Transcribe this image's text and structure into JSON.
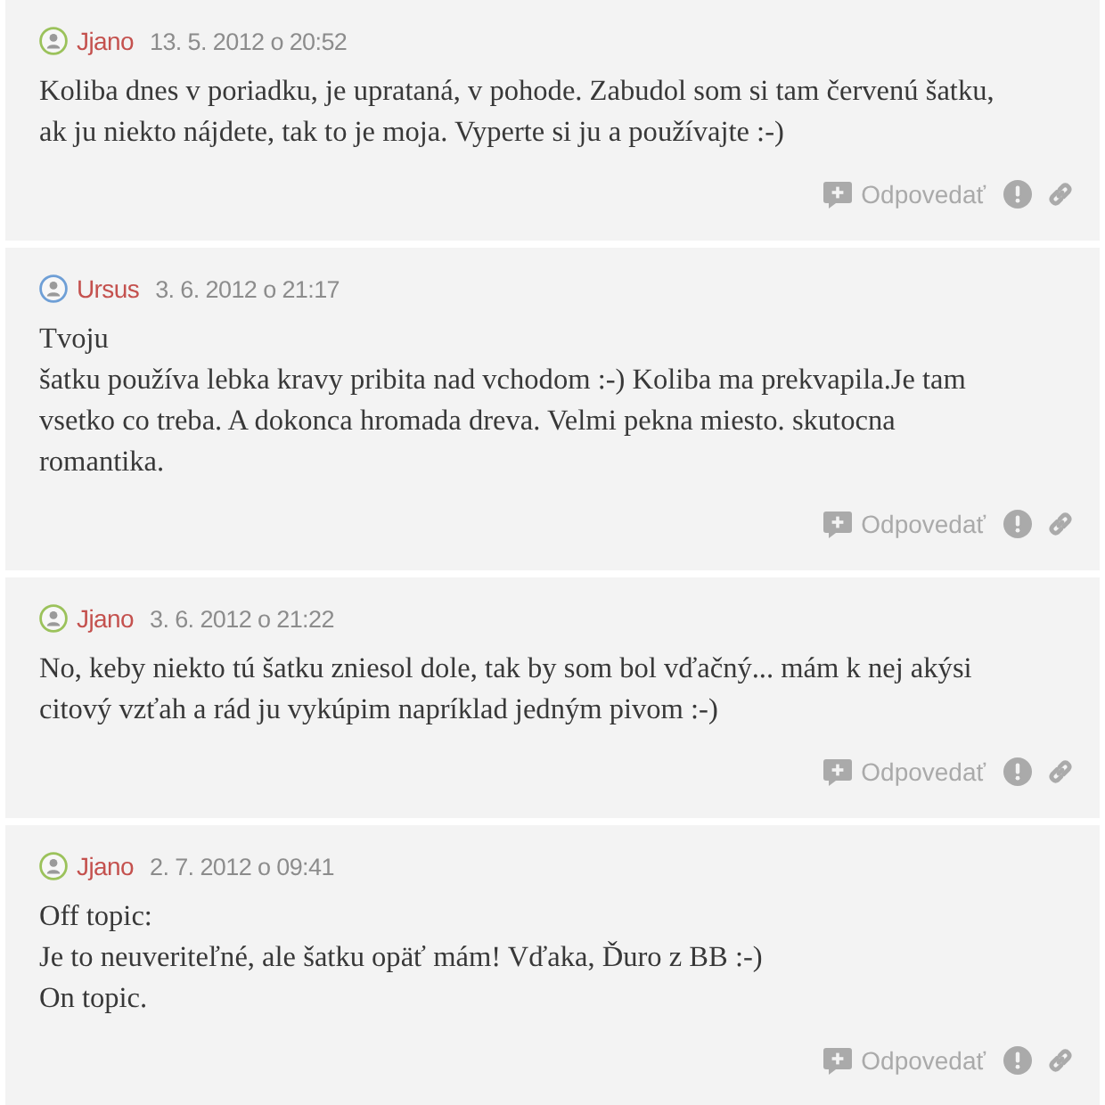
{
  "comments": [
    {
      "author": "Jjano",
      "color": "#9bc25b",
      "date": "13. 5. 2012 o 20:52",
      "text": "Koliba dnes v poriadku, je uprataná, v pohode. Zabudol som si tam červenú šatku,\nak ju niekto nájdete, tak to je moja. Vyperte si ju a používajte :-)",
      "reply_label": "Odpovedať"
    },
    {
      "author": "Ursus",
      "color": "#6e9fd6",
      "date": "3. 6. 2012 o 21:17",
      "text": "Tvoju\nšatku používa lebka kravy pribita nad vchodom :-) Koliba ma prekvapila.Je tam\nvsetko co treba. A dokonca hromada dreva. Velmi pekna miesto. skutocna\nromantika.",
      "reply_label": "Odpovedať"
    },
    {
      "author": "Jjano",
      "color": "#9bc25b",
      "date": "3. 6. 2012 o 21:22",
      "text": "No, keby niekto tú šatku zniesol dole, tak by som bol vďačný... mám k nej akýsi\ncitový vzťah a rád ju vykúpim napríklad jedným pivom :-)",
      "reply_label": "Odpovedať"
    },
    {
      "author": "Jjano",
      "color": "#9bc25b",
      "date": "2. 7. 2012 o 09:41",
      "text": "Off topic:\nJe to neuveriteľné, ale šatku opäť mám! Vďaka, Ďuro z BB :-)\nOn topic.",
      "reply_label": "Odpovedať"
    }
  ]
}
